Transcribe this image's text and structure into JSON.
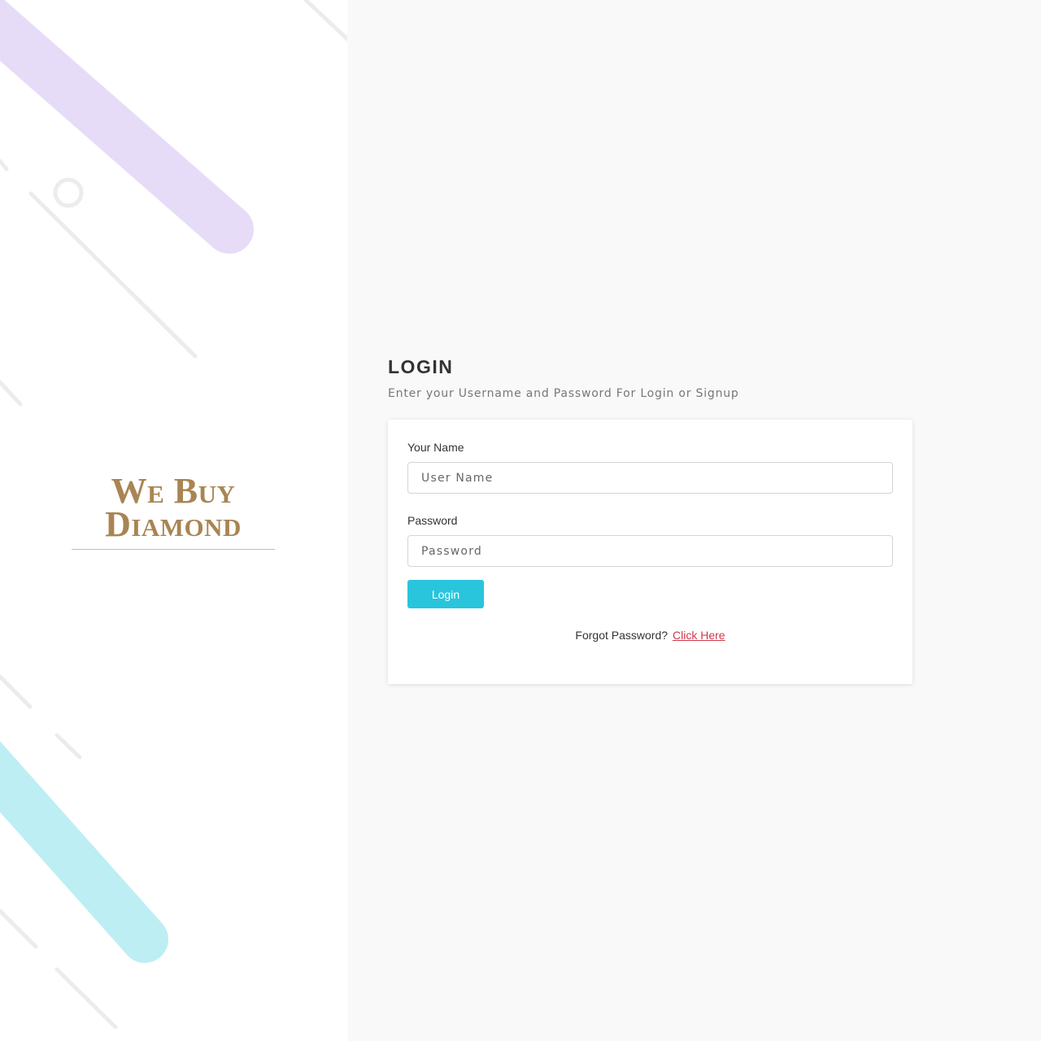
{
  "brand": {
    "line1": "We Buy",
    "line2": "Diamond",
    "color": "#a88553"
  },
  "login": {
    "title": "LOGIN",
    "subtitle": "Enter your Username and Password For Login or Signup",
    "username_label": "Your Name",
    "username_placeholder": "User Name",
    "password_label": "Password",
    "password_placeholder": "Password",
    "button_label": "Login",
    "forgot_text": "Forgot Password?",
    "forgot_link": "Click Here"
  },
  "colors": {
    "accent": "#29c5dd",
    "link": "#d0374a",
    "deco_purple": "#e6dcf7",
    "deco_cyan": "#bdeef3"
  }
}
